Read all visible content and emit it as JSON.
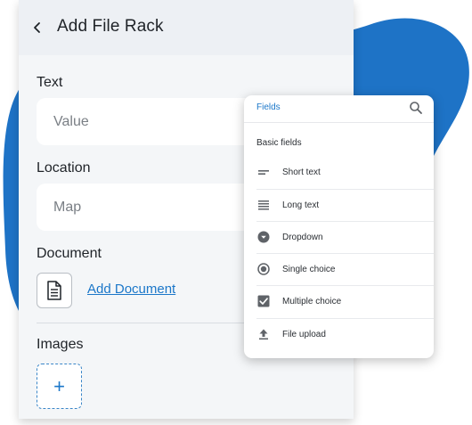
{
  "colors": {
    "accent": "#1b77c9",
    "blob": "#1e73c6",
    "card_bg": "#f4f6f8",
    "header_bg": "#edf0f4"
  },
  "form": {
    "title": "Add File Rack",
    "back_icon": "chevron-left-icon",
    "fields": [
      {
        "label": "Text",
        "placeholder": "Value"
      },
      {
        "label": "Location",
        "placeholder": "Map"
      }
    ],
    "document": {
      "label": "Document",
      "icon": "document-icon",
      "link_label": "Add Document"
    },
    "images": {
      "label": "Images",
      "add_label": "+"
    }
  },
  "fields_panel": {
    "title": "Fields",
    "search_icon": "search-icon",
    "section": "Basic fields",
    "options": [
      {
        "label": "Short text",
        "icon": "short-text-icon"
      },
      {
        "label": "Long text",
        "icon": "long-text-icon"
      },
      {
        "label": "Dropdown",
        "icon": "dropdown-icon"
      },
      {
        "label": "Single choice",
        "icon": "radio-icon"
      },
      {
        "label": "Multiple choice",
        "icon": "checkbox-icon"
      },
      {
        "label": "File upload",
        "icon": "upload-icon"
      }
    ]
  }
}
